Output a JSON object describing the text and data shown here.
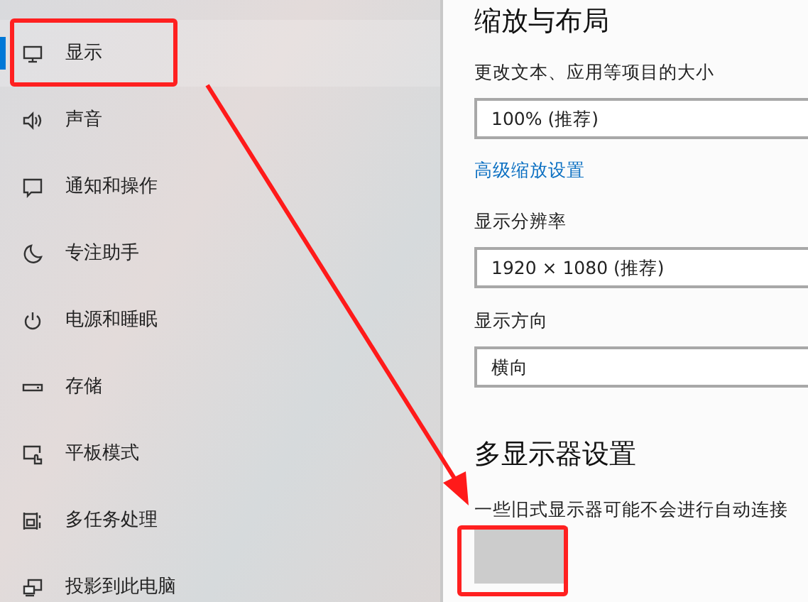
{
  "sidebar": {
    "items": [
      {
        "label": "显示",
        "selected": true
      },
      {
        "label": "声音",
        "selected": false
      },
      {
        "label": "通知和操作",
        "selected": false
      },
      {
        "label": "专注助手",
        "selected": false
      },
      {
        "label": "电源和睡眠",
        "selected": false
      },
      {
        "label": "存储",
        "selected": false
      },
      {
        "label": "平板模式",
        "selected": false
      },
      {
        "label": "多任务处理",
        "selected": false
      },
      {
        "label": "投影到此电脑",
        "selected": false
      }
    ]
  },
  "content": {
    "sections": [
      {
        "heading": "缩放与布局",
        "items": [
          {
            "kind": "label",
            "text": "更改文本、应用等项目的大小"
          },
          {
            "kind": "dropdown",
            "value": "100% (推荐)"
          },
          {
            "kind": "link",
            "text": "高级缩放设置"
          },
          {
            "kind": "label",
            "text": "显示分辨率"
          },
          {
            "kind": "dropdown",
            "value": "1920 × 1080 (推荐)"
          },
          {
            "kind": "label",
            "text": "显示方向"
          },
          {
            "kind": "dropdown",
            "value": "横向"
          }
        ]
      },
      {
        "heading": "多显示器设置",
        "items": [
          {
            "kind": "text",
            "text": "一些旧式显示器可能不会进行自动连接"
          },
          {
            "kind": "button"
          }
        ]
      }
    ]
  }
}
